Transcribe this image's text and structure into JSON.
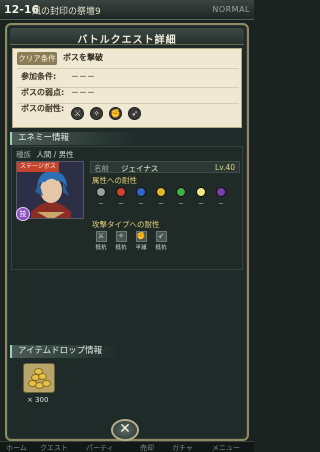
{
  "header": {
    "stage_no": "12-16",
    "stage_name": "風の封印の祭壇9",
    "difficulty": "NORMAL"
  },
  "dialog": {
    "title": "バトルクエスト詳細"
  },
  "conditions": {
    "clear_label": "クリア条件",
    "clear_value": "ボスを撃破",
    "join_label": "参加条件:",
    "join_value": "－－－",
    "weak_label": "ボスの弱点:",
    "weak_value": "－－－",
    "resist_label": "ボスの耐性:",
    "resist_icons": [
      "sword-icon",
      "claw-icon",
      "fist-icon",
      "spear-icon"
    ]
  },
  "enemy": {
    "section_label": "エネミー情報",
    "race_label": "種族",
    "race_value": "人間 / 男性",
    "badge": "ステージボス",
    "skill_badge": "技",
    "name_label": "名前",
    "name_value": "ジェイナス",
    "level": "Lv.40",
    "attr_title": "属性への耐性",
    "attributes": [
      {
        "name": "neutral",
        "color": "#9aa09a",
        "mark": "－"
      },
      {
        "name": "fire",
        "color": "#d0432e",
        "mark": "－"
      },
      {
        "name": "water",
        "color": "#2f67c9",
        "mark": "－"
      },
      {
        "name": "thunder",
        "color": "#e1b826",
        "mark": "－"
      },
      {
        "name": "wind",
        "color": "#3fae4a",
        "mark": "－"
      },
      {
        "name": "light",
        "color": "#f0e88a",
        "mark": "－"
      },
      {
        "name": "dark",
        "color": "#7a3fa8",
        "mark": "－"
      }
    ],
    "atk_title": "攻撃タイプへの耐性",
    "attack_types": [
      {
        "icon": "sword-icon",
        "label": "抵抗"
      },
      {
        "icon": "claw-icon",
        "label": "抵抗"
      },
      {
        "icon": "fist-icon",
        "label": "半減"
      },
      {
        "icon": "spear-icon",
        "label": "抵抗"
      }
    ]
  },
  "drops": {
    "section_label": "アイテムドロップ情報",
    "item_icon": "gold-coins-icon",
    "quantity": "× 300"
  },
  "close_label": "✕",
  "tabs": [
    "ホーム",
    "クエスト",
    "パーティ",
    "売却",
    "ガチャ",
    "メニュー"
  ]
}
